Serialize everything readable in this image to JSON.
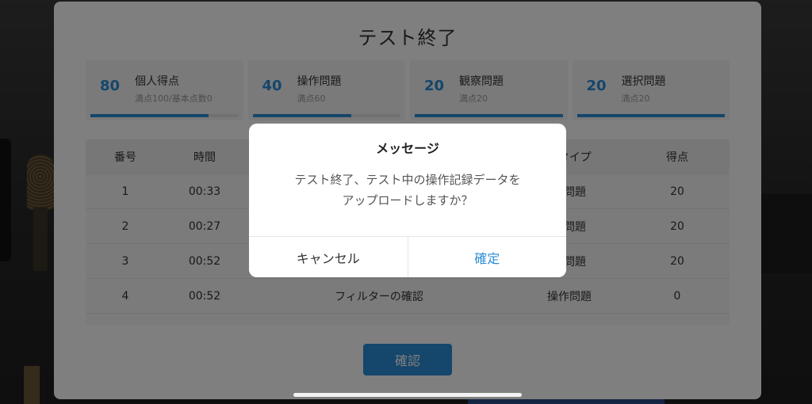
{
  "card": {
    "title": "テスト終了",
    "scores": [
      {
        "value": "80",
        "label": "個人得点",
        "sub": "満点100/基本点数0",
        "progress": 0.8
      },
      {
        "value": "40",
        "label": "操作問題",
        "sub": "満点60",
        "progress": 0.67
      },
      {
        "value": "20",
        "label": "観察問題",
        "sub": "満点20",
        "progress": 1.0
      },
      {
        "value": "20",
        "label": "選択問題",
        "sub": "満点20",
        "progress": 1.0
      }
    ],
    "table": {
      "headers": [
        "番号",
        "時間",
        "",
        "クタイプ",
        "得点"
      ],
      "rows": [
        [
          "1",
          "00:33",
          "",
          "作問題",
          "20"
        ],
        [
          "2",
          "00:27",
          "",
          "察問題",
          "20"
        ],
        [
          "3",
          "00:52",
          "",
          "択問題",
          "20"
        ],
        [
          "4",
          "00:52",
          "フィルターの確認",
          "操作問題",
          "0"
        ]
      ]
    },
    "confirm_label": "確認"
  },
  "dialog": {
    "title": "メッセージ",
    "message_line1": "テスト終了、テスト中の操作記録データを",
    "message_line2": "アップロードしますか？",
    "cancel_label": "キャンセル",
    "ok_label": "確定"
  },
  "colors": {
    "accent": "#2b8cd6",
    "overlay": "rgba(0,0,0,0.5)"
  }
}
